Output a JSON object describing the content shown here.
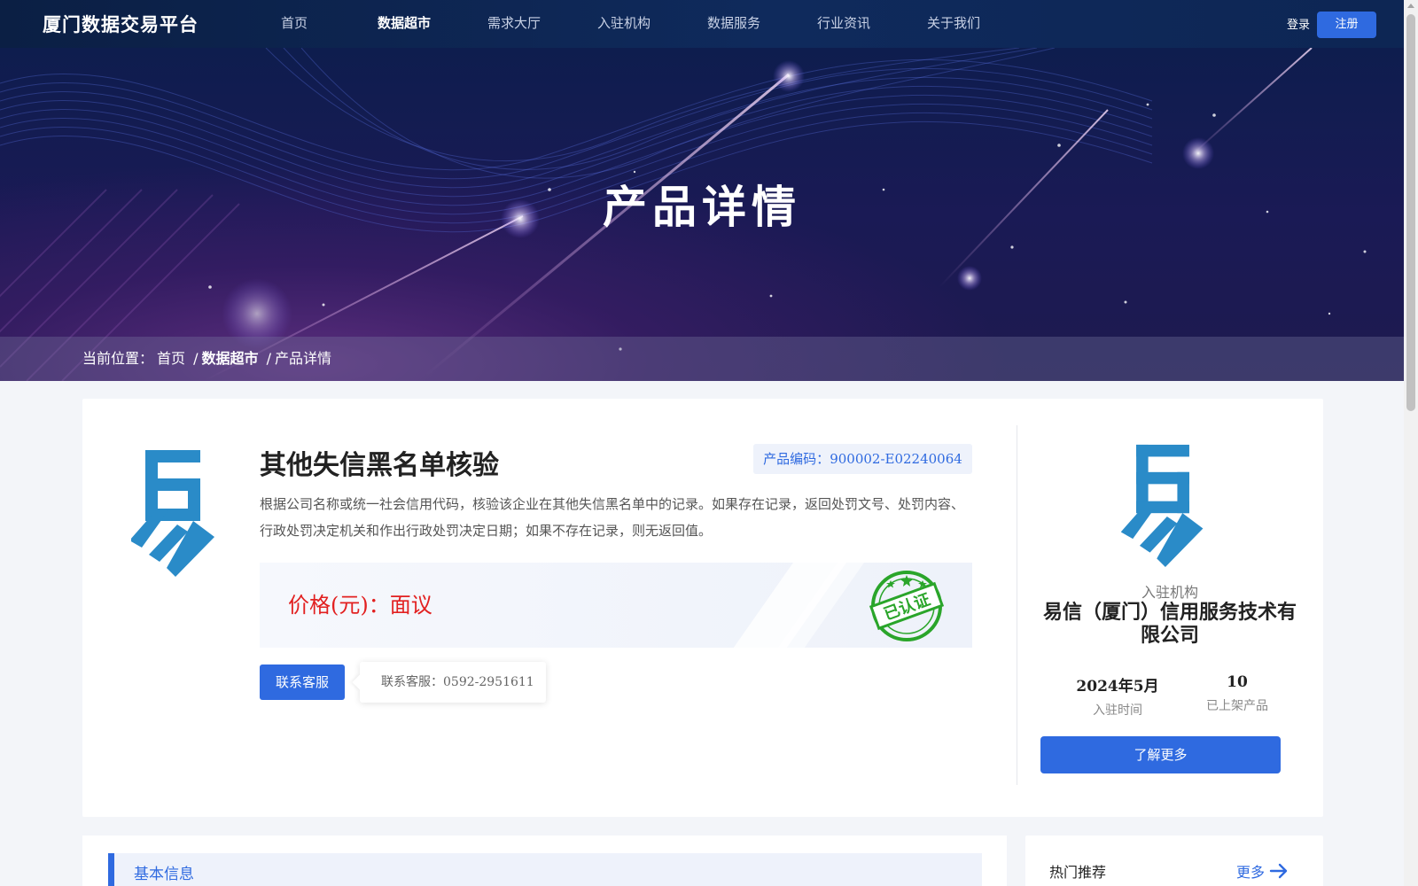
{
  "header": {
    "logo_text": "厦门数据交易平台",
    "nav": [
      {
        "label": "首页",
        "active": false
      },
      {
        "label": "数据超市",
        "active": true
      },
      {
        "label": "需求大厅",
        "active": false
      },
      {
        "label": "入驻机构",
        "active": false
      },
      {
        "label": "数据服务",
        "active": false
      },
      {
        "label": "行业资讯",
        "active": false
      },
      {
        "label": "关于我们",
        "active": false
      }
    ],
    "login_label": "登录",
    "register_label": "注册"
  },
  "banner": {
    "title": "产品详情",
    "breadcrumb": {
      "prefix": "当前位置：",
      "home": "首页",
      "sep1": "/",
      "section": "数据超市",
      "sep2": "/",
      "current": "产品详情"
    }
  },
  "product": {
    "title": "其他失信黑名单核验",
    "code_label": "产品编码：",
    "code": "900002-E02240064",
    "description": "根据公司名称或统一社会信用代码，核验该企业在其他失信黑名单中的记录。如果存在记录，返回处罚文号、处罚内容、行政处罚决定机关和作出行政处罚决定日期；如果不存在记录，则无返回值。",
    "price_label": "价格(元)：",
    "price_value": "面议",
    "stamp_text": "已认证",
    "contact_button": "联系客服",
    "contact_tip_label": "联系客服：",
    "contact_phone": "0592-2951611"
  },
  "org": {
    "label": "入驻机构",
    "name": "易信（厦门）信用服务技术有限公司",
    "join_time": "2024年5月",
    "join_time_label": "入驻时间",
    "product_count": "10",
    "product_count_label": "已上架产品",
    "more_button": "了解更多"
  },
  "sections": {
    "basic_info_title": "基本信息",
    "hot_title": "热门推荐",
    "hot_more": "更多"
  },
  "colors": {
    "accent": "#2f6ae0",
    "logo_blue": "#2a8bc8",
    "price_red": "#e22020",
    "stamp_green": "#2aa52a",
    "header_bg": "#0f2a5c"
  }
}
